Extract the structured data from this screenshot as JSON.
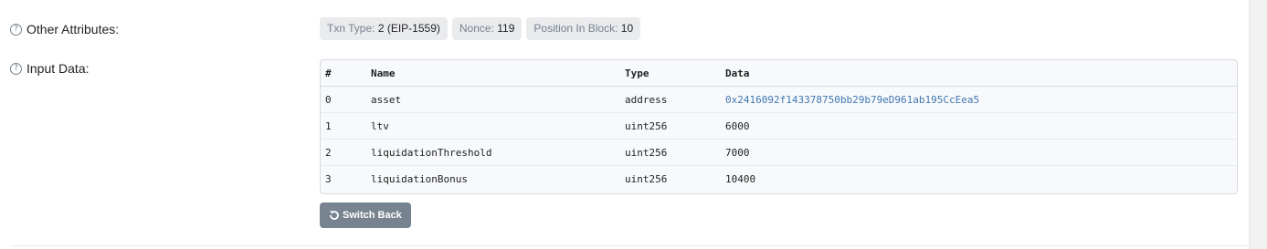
{
  "other_attributes": {
    "label": "Other Attributes:",
    "badges": [
      {
        "key": "Txn Type:",
        "value": "2 (EIP-1559)"
      },
      {
        "key": "Nonce:",
        "value": "119"
      },
      {
        "key": "Position In Block:",
        "value": "10"
      }
    ]
  },
  "input_data": {
    "label": "Input Data:",
    "headers": {
      "index": "#",
      "name": "Name",
      "type": "Type",
      "data": "Data"
    },
    "rows": [
      {
        "index": "0",
        "name": "asset",
        "type": "address",
        "data": "0x2416092f143378750bb29b79eD961ab195CcEea5"
      },
      {
        "index": "1",
        "name": "ltv",
        "type": "uint256",
        "data": "6000"
      },
      {
        "index": "2",
        "name": "liquidationThreshold",
        "type": "uint256",
        "data": "7000"
      },
      {
        "index": "3",
        "name": "liquidationBonus",
        "type": "uint256",
        "data": "10400"
      }
    ],
    "switch_button_label": "Switch Back"
  },
  "icons": {
    "help": "question-circle-icon",
    "switch": "undo-icon"
  },
  "colors": {
    "link": "#3f78b5",
    "button": "#77838f",
    "badge_bg": "#eaebed"
  }
}
